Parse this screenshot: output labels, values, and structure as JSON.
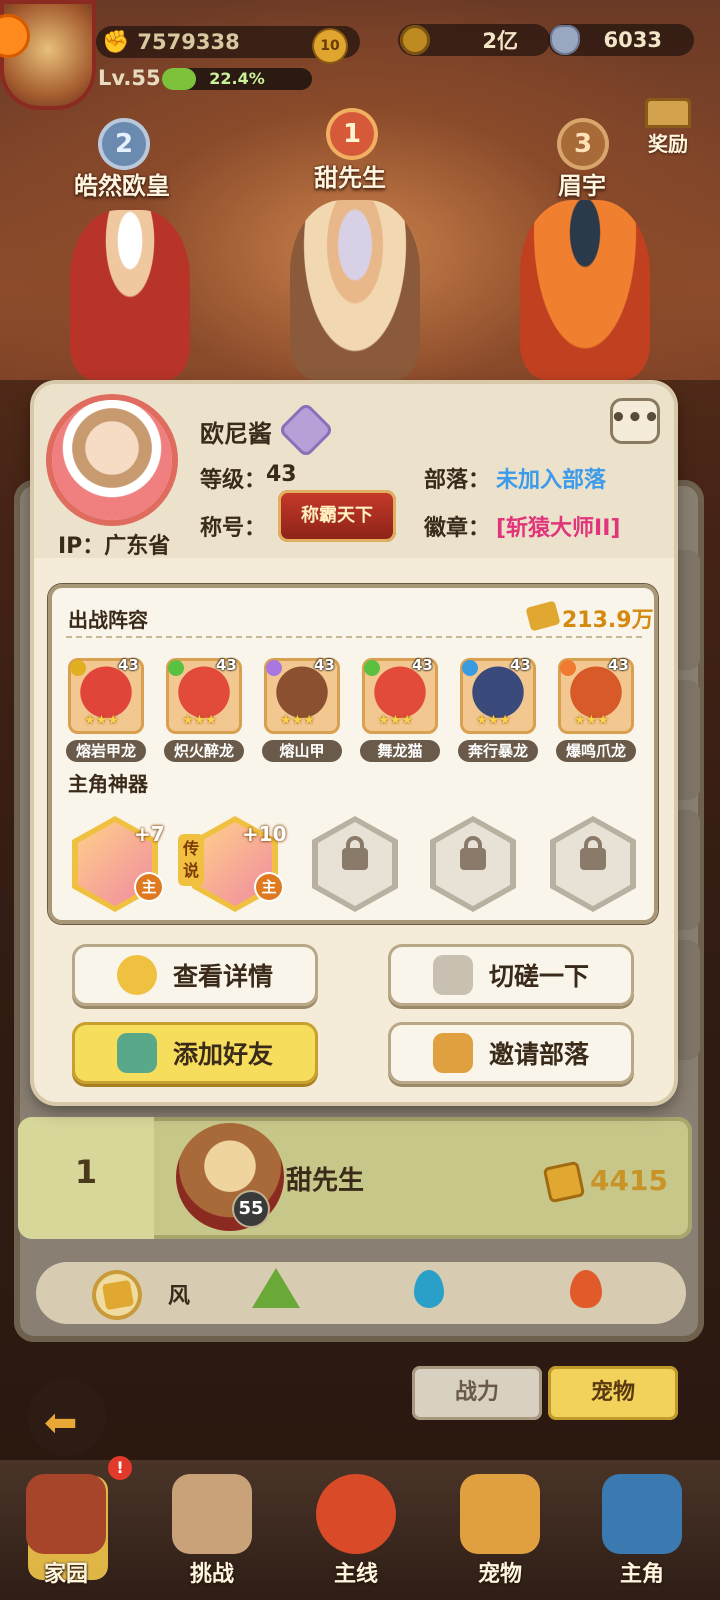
{
  "topbar": {
    "power_value": "7579338",
    "vip_level": "10",
    "level": "Lv.55",
    "xp_percent": "22.4%",
    "xp_fraction": 0.224,
    "coins": "2亿",
    "gems": "6033",
    "reward_label": "奖励"
  },
  "podium": {
    "first": {
      "rank": "1",
      "name": "甜先生"
    },
    "second": {
      "rank": "2",
      "name": "皓然欧皇"
    },
    "third": {
      "rank": "3",
      "name": "眉宇"
    }
  },
  "profile": {
    "name": "欧尼酱",
    "ip": "IP：广东省",
    "level_label": "等级：",
    "level_value": "43",
    "tribe_label": "部落：",
    "tribe_value": "未加入部落",
    "title_label": "称号：",
    "title_value": "称霸天下",
    "badge_label": "徽章：",
    "badge_value": "[斩猿大师II]",
    "more_label": "•••",
    "colors": {
      "tribe": "#3d9bea",
      "badge": "#e0357a"
    }
  },
  "team": {
    "section_title": "出战阵容",
    "power": "213.9万",
    "pets": [
      {
        "name": "熔岩甲龙",
        "level": "43",
        "stars": "★★★",
        "type_color": "#e0b020",
        "color": "#e0443a"
      },
      {
        "name": "炽火醉龙",
        "level": "43",
        "stars": "★★★",
        "type_color": "#5ac040",
        "color": "#e24a3a"
      },
      {
        "name": "熔山甲",
        "level": "43",
        "stars": "★★★",
        "type_color": "#a878e0",
        "color": "#8a5030"
      },
      {
        "name": "舞龙猫",
        "level": "43",
        "stars": "★★★",
        "type_color": "#5ac040",
        "color": "#e24a3a"
      },
      {
        "name": "奔行暴龙",
        "level": "43",
        "stars": "★★★",
        "type_color": "#3a9ae0",
        "color": "#3a4a7a"
      },
      {
        "name": "爆鸣爪龙",
        "level": "43",
        "stars": "★★★",
        "type_color": "#f07a30",
        "color": "#d85a28"
      }
    ]
  },
  "artifacts": {
    "section_title": "主角神器",
    "items": [
      {
        "plus": "+7",
        "main": "主",
        "locked": false
      },
      {
        "plus": "+10",
        "main": "主",
        "legend": "传说",
        "locked": false
      },
      {
        "locked": true
      },
      {
        "locked": true
      },
      {
        "locked": true
      }
    ]
  },
  "actions": {
    "details": "查看详情",
    "spar": "切磋一下",
    "add_friend": "添加好友",
    "invite_tribe": "邀请部落"
  },
  "my_row": {
    "rank": "1",
    "name": "甜先生",
    "level": "55",
    "power": "4415"
  },
  "filters": {
    "active_label": "风"
  },
  "toggles": {
    "power": "战力",
    "pet": "宠物"
  },
  "nav": {
    "home": "家园",
    "challenge": "挑战",
    "main": "主线",
    "pet": "宠物",
    "hero": "主角",
    "home_badge": "!"
  }
}
